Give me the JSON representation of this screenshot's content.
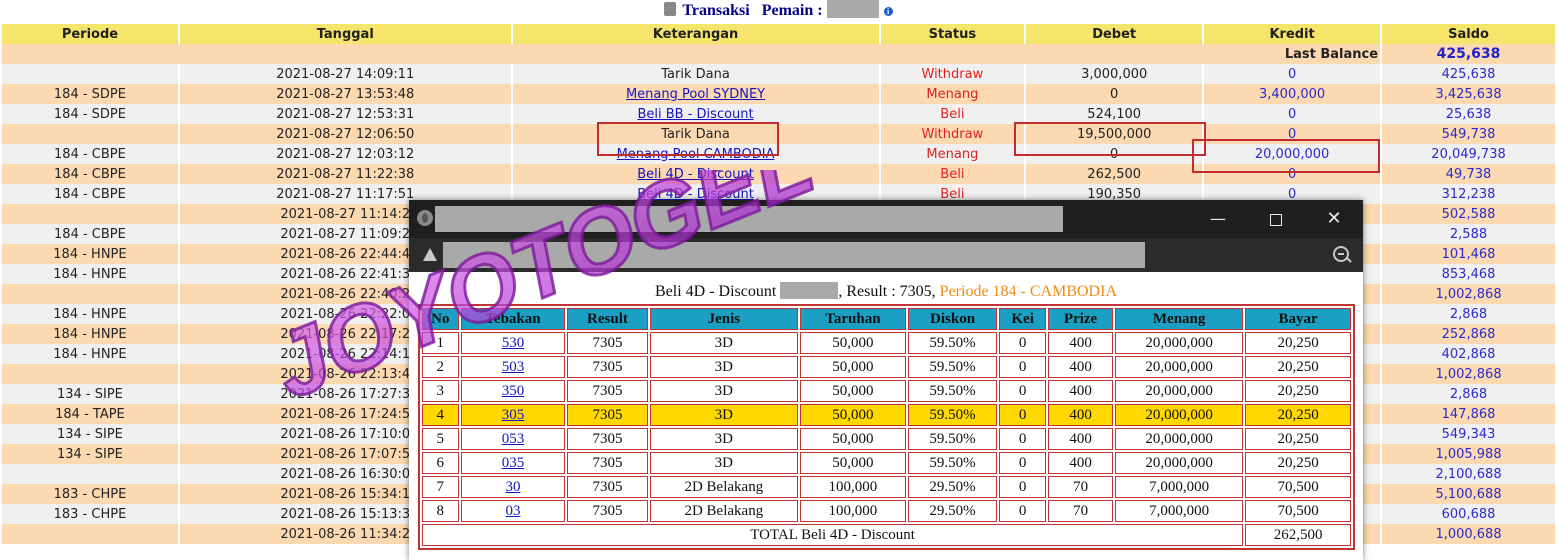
{
  "page_title": {
    "label": "Transaksi",
    "pemain_label": "Pemain :"
  },
  "columns": [
    "Periode",
    "Tanggal",
    "Keterangan",
    "Status",
    "Debet",
    "Kredit",
    "Saldo"
  ],
  "last_balance": {
    "label": "Last Balance",
    "value": "425,638"
  },
  "rows": [
    {
      "periode": "",
      "tanggal": "2021-08-27 14:09:11",
      "ket": "Tarik Dana",
      "link": false,
      "status": "Withdraw",
      "debet": "3,000,000",
      "kredit": "0",
      "saldo": "425,638"
    },
    {
      "periode": "184 - SDPE",
      "tanggal": "2021-08-27 13:53:48",
      "ket": "Menang Pool SYDNEY",
      "link": true,
      "status": "Menang",
      "debet": "0",
      "kredit": "3,400,000",
      "saldo": "3,425,638"
    },
    {
      "periode": "184 - SDPE",
      "tanggal": "2021-08-27 12:53:31",
      "ket": "Beli BB - Discount",
      "link": true,
      "status": "Beli",
      "debet": "524,100",
      "kredit": "0",
      "saldo": "25,638"
    },
    {
      "periode": "",
      "tanggal": "2021-08-27 12:06:50",
      "ket": "Tarik Dana",
      "link": false,
      "status": "Withdraw",
      "debet": "19,500,000",
      "kredit": "0",
      "saldo": "549,738"
    },
    {
      "periode": "184 - CBPE",
      "tanggal": "2021-08-27 12:03:12",
      "ket": "Menang Pool CAMBODIA",
      "link": true,
      "status": "Menang",
      "debet": "0",
      "kredit": "20,000,000",
      "saldo": "20,049,738"
    },
    {
      "periode": "184 - CBPE",
      "tanggal": "2021-08-27 11:22:38",
      "ket": "Beli 4D - Discount",
      "link": true,
      "status": "Beli",
      "debet": "262,500",
      "kredit": "0",
      "saldo": "49,738"
    },
    {
      "periode": "184 - CBPE",
      "tanggal": "2021-08-27 11:17:51",
      "ket": "Beli 4D - Discount",
      "link": true,
      "status": "Beli",
      "debet": "190,350",
      "kredit": "0",
      "saldo": "312,238"
    },
    {
      "periode": "",
      "tanggal": "2021-08-27 11:14:2",
      "ket": "",
      "link": false,
      "status": "",
      "debet": "",
      "kredit": "",
      "saldo": "502,588"
    },
    {
      "periode": "184 - CBPE",
      "tanggal": "2021-08-27 11:09:2",
      "ket": "",
      "link": false,
      "status": "",
      "debet": "",
      "kredit": "",
      "saldo": "2,588"
    },
    {
      "periode": "184 - HNPE",
      "tanggal": "2021-08-26 22:44:4",
      "ket": "",
      "link": false,
      "status": "",
      "debet": "",
      "kredit": "",
      "saldo": "101,468"
    },
    {
      "periode": "184 - HNPE",
      "tanggal": "2021-08-26 22:41:3",
      "ket": "",
      "link": false,
      "status": "",
      "debet": "",
      "kredit": "",
      "saldo": "853,468"
    },
    {
      "periode": "",
      "tanggal": "2021-08-26 22:40:2",
      "ket": "",
      "link": false,
      "status": "",
      "debet": "",
      "kredit": "",
      "saldo": "1,002,868"
    },
    {
      "periode": "184 - HNPE",
      "tanggal": "2021-08-26 22:22:0",
      "ket": "",
      "link": false,
      "status": "",
      "debet": "",
      "kredit": "",
      "saldo": "2,868"
    },
    {
      "periode": "184 - HNPE",
      "tanggal": "2021-08-26 22:17:2",
      "ket": "",
      "link": false,
      "status": "",
      "debet": "",
      "kredit": "",
      "saldo": "252,868"
    },
    {
      "periode": "184 - HNPE",
      "tanggal": "2021-08-26 22:14:1",
      "ket": "",
      "link": false,
      "status": "",
      "debet": "",
      "kredit": "",
      "saldo": "402,868"
    },
    {
      "periode": "",
      "tanggal": "2021-08-26 22:13:4",
      "ket": "",
      "link": false,
      "status": "",
      "debet": "",
      "kredit": "",
      "saldo": "1,002,868"
    },
    {
      "periode": "134 - SIPE",
      "tanggal": "2021-08-26 17:27:3",
      "ket": "",
      "link": false,
      "status": "",
      "debet": "",
      "kredit": "",
      "saldo": "2,868"
    },
    {
      "periode": "184 - TAPE",
      "tanggal": "2021-08-26 17:24:5",
      "ket": "",
      "link": false,
      "status": "",
      "debet": "",
      "kredit": "",
      "saldo": "147,868"
    },
    {
      "periode": "134 - SIPE",
      "tanggal": "2021-08-26 17:10:0",
      "ket": "",
      "link": false,
      "status": "",
      "debet": "",
      "kredit": "",
      "saldo": "549,343"
    },
    {
      "periode": "134 - SIPE",
      "tanggal": "2021-08-26 17:07:5",
      "ket": "",
      "link": false,
      "status": "",
      "debet": "",
      "kredit": "",
      "saldo": "1,005,988"
    },
    {
      "periode": "",
      "tanggal": "2021-08-26 16:30:0",
      "ket": "",
      "link": false,
      "status": "",
      "debet": "",
      "kredit": "",
      "saldo": "2,100,688"
    },
    {
      "periode": "183 - CHPE",
      "tanggal": "2021-08-26 15:34:1",
      "ket": "",
      "link": false,
      "status": "",
      "debet": "",
      "kredit": "",
      "saldo": "5,100,688"
    },
    {
      "periode": "183 - CHPE",
      "tanggal": "2021-08-26 15:13:3",
      "ket": "",
      "link": false,
      "status": "",
      "debet": "",
      "kredit": "",
      "saldo": "600,688"
    },
    {
      "periode": "",
      "tanggal": "2021-08-26 11:34:2",
      "ket": "",
      "link": false,
      "status": "",
      "debet": "",
      "kredit": "",
      "saldo": "1,000,688"
    }
  ],
  "popup": {
    "title_prefix": "Beli 4D - Discount",
    "result_text": ", Result : 7305,",
    "periode_text": "Periode 184 - CAMBODIA",
    "columns": [
      "No",
      "Tebakan",
      "Result",
      "Jenis",
      "Taruhan",
      "Diskon",
      "Kei",
      "Prize",
      "Menang",
      "Bayar"
    ],
    "rows": [
      {
        "no": "1",
        "tebakan": "530",
        "result": "7305",
        "jenis": "3D",
        "taruhan": "50,000",
        "diskon": "59.50%",
        "kei": "0",
        "prize": "400",
        "menang": "20,000,000",
        "bayar": "20,250",
        "highlight": false
      },
      {
        "no": "2",
        "tebakan": "503",
        "result": "7305",
        "jenis": "3D",
        "taruhan": "50,000",
        "diskon": "59.50%",
        "kei": "0",
        "prize": "400",
        "menang": "20,000,000",
        "bayar": "20,250",
        "highlight": false
      },
      {
        "no": "3",
        "tebakan": "350",
        "result": "7305",
        "jenis": "3D",
        "taruhan": "50,000",
        "diskon": "59.50%",
        "kei": "0",
        "prize": "400",
        "menang": "20,000,000",
        "bayar": "20,250",
        "highlight": false
      },
      {
        "no": "4",
        "tebakan": "305",
        "result": "7305",
        "jenis": "3D",
        "taruhan": "50,000",
        "diskon": "59.50%",
        "kei": "0",
        "prize": "400",
        "menang": "20,000,000",
        "bayar": "20,250",
        "highlight": true
      },
      {
        "no": "5",
        "tebakan": "053",
        "result": "7305",
        "jenis": "3D",
        "taruhan": "50,000",
        "diskon": "59.50%",
        "kei": "0",
        "prize": "400",
        "menang": "20,000,000",
        "bayar": "20,250",
        "highlight": false
      },
      {
        "no": "6",
        "tebakan": "035",
        "result": "7305",
        "jenis": "3D",
        "taruhan": "50,000",
        "diskon": "59.50%",
        "kei": "0",
        "prize": "400",
        "menang": "20,000,000",
        "bayar": "20,250",
        "highlight": false
      },
      {
        "no": "7",
        "tebakan": "30",
        "result": "7305",
        "jenis": "2D Belakang",
        "taruhan": "100,000",
        "diskon": "29.50%",
        "kei": "0",
        "prize": "70",
        "menang": "7,000,000",
        "bayar": "70,500",
        "highlight": false
      },
      {
        "no": "8",
        "tebakan": "03",
        "result": "7305",
        "jenis": "2D Belakang",
        "taruhan": "100,000",
        "diskon": "29.50%",
        "kei": "0",
        "prize": "70",
        "menang": "7,000,000",
        "bayar": "70,500",
        "highlight": false
      }
    ],
    "total_label": "TOTAL  Beli 4D - Discount",
    "total_value": "262,500"
  },
  "watermark": {
    "text": "JOYOTOGEL"
  },
  "colors": {
    "header": "#f5e56b",
    "row_peach": "#fcd9b0",
    "row_grey": "#f0f0f0",
    "status_red": "#dd2222",
    "link_blue": "#1515c0",
    "popup_header": "#1b9fc2",
    "highlight": "#ffd800",
    "periode_orange": "#f08a1a"
  }
}
